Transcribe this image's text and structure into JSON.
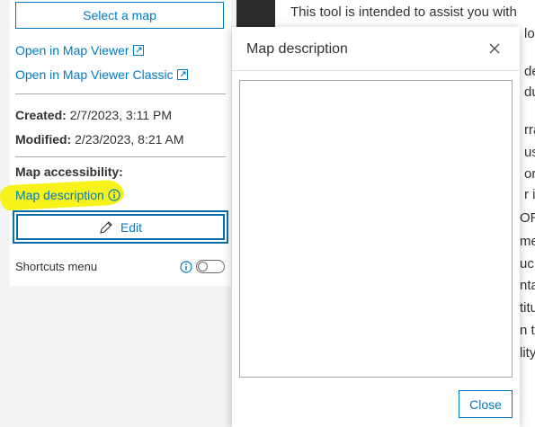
{
  "left_panel": {
    "select_map_label": "Select a map",
    "open_map_viewer": "Open in Map Viewer",
    "open_map_viewer_classic": "Open in Map Viewer Classic",
    "created_label": "Created:",
    "created_value": "2/7/2023, 3:11 PM",
    "modified_label": "Modified:",
    "modified_value": "2/23/2023, 8:21 AM",
    "accessibility_label": "Map accessibility:",
    "map_description_link": "Map description",
    "edit_label": "Edit",
    "shortcuts_label": "Shortcuts menu",
    "shortcuts_enabled": false
  },
  "background": {
    "intro_text": "This tool is intended to assist you with",
    "fragments": [
      "lo",
      "de",
      "du",
      "rra",
      "us",
      "or",
      "r i",
      "OR",
      "me",
      "uc",
      "nta",
      "titu",
      "n t",
      "lity"
    ]
  },
  "modal": {
    "title": "Map description",
    "textarea_value": "",
    "close_label": "Close"
  },
  "colors": {
    "accent": "#007ac2",
    "highlight": "#f7f21a",
    "focus_outline": "#0a6ea6"
  }
}
